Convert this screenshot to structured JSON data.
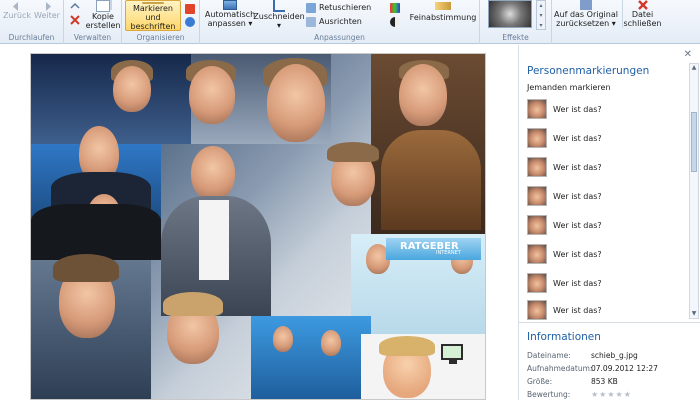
{
  "ribbon": {
    "groups": {
      "navigate": "Durchlaufen",
      "manage": "Verwalten",
      "organize": "Organisieren",
      "adjust": "Anpassungen",
      "effects": "Effekte"
    },
    "back": "Zurück",
    "forward": "Weiter",
    "copy_line1": "Kopie",
    "copy_line2": "erstellen",
    "tag_line1": "Markieren und",
    "tag_line2": "beschriften",
    "auto_line1": "Automatisch",
    "auto_line2": "anpassen",
    "crop": "Zuschneiden",
    "retouch": "Retuschieren",
    "straighten": "Ausrichten",
    "finetune": "Feinabstimmung",
    "revert_line1": "Auf das Original",
    "revert_line2": "zurücksetzen",
    "close_line1": "Datei",
    "close_line2": "schließen"
  },
  "photo": {
    "banner_title": "RATGEBER",
    "banner_sub": "INTERNET"
  },
  "panel": {
    "people_title": "Personenmarkierungen",
    "tag_someone": "Jemanden markieren",
    "people": [
      {
        "label": "Wer ist das?"
      },
      {
        "label": "Wer ist das?"
      },
      {
        "label": "Wer ist das?"
      },
      {
        "label": "Wer ist das?"
      },
      {
        "label": "Wer ist das?"
      },
      {
        "label": "Wer ist das?"
      },
      {
        "label": "Wer ist das?"
      },
      {
        "label": "Wer ist das?"
      }
    ],
    "info_title": "Informationen",
    "info": {
      "filename_label": "Dateiname:",
      "filename": "schieb_g.jpg",
      "date_label": "Aufnahmedatum:",
      "date": "07.09.2012  12:27",
      "size_label": "Größe:",
      "size": "853 KB",
      "rating_label": "Bewertung:",
      "rating_value": 0
    }
  },
  "colors": {
    "accent": "#1f5fa5",
    "selected_bg": "#fdd76b",
    "ribbon_bg": "#e4ecf6"
  }
}
